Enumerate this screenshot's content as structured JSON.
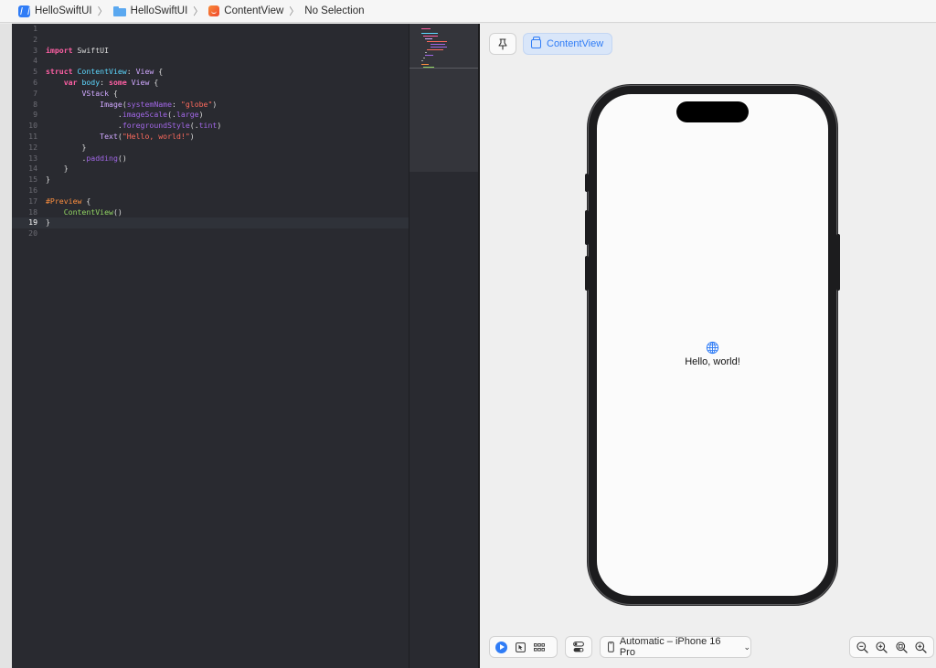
{
  "jumpbar": {
    "project": "HelloSwiftUI",
    "group": "HelloSwiftUI",
    "file": "ContentView",
    "selection": "No Selection"
  },
  "editor": {
    "active_line": 19,
    "line_numbers": [
      "1",
      "2",
      "3",
      "4",
      "5",
      "6",
      "7",
      "8",
      "9",
      "10",
      "11",
      "12",
      "13",
      "14",
      "15",
      "16",
      "17",
      "18",
      "19",
      "20"
    ],
    "code": {
      "l3_kw": "import",
      "l3_mod": " SwiftUI",
      "l5_kw": "struct",
      "l5_name": " ContentView",
      "l5_colon": ": ",
      "l5_proto": "View",
      "l5_brace": " {",
      "l6_kw": "var",
      "l6_name": " body",
      "l6_colon": ": ",
      "l6_some": "some",
      "l6_type": " View",
      "l6_brace": " {",
      "l7_type": "VStack",
      "l7_brace": " {",
      "l8_type": "Image",
      "l8_open": "(",
      "l8_label": "systemName",
      "l8_colon": ": ",
      "l8_str": "\"globe\"",
      "l8_close": ")",
      "l9_dot": ".",
      "l9_fn": "imageScale",
      "l9_open": "(.",
      "l9_arg": "large",
      "l9_close": ")",
      "l10_dot": ".",
      "l10_fn": "foregroundStyle",
      "l10_open": "(.",
      "l10_arg": "tint",
      "l10_close": ")",
      "l11_type": "Text",
      "l11_open": "(",
      "l11_str": "\"Hello, world!\"",
      "l11_close": ")",
      "l12": "}",
      "l13_dot": ".",
      "l13_fn": "padding",
      "l13_paren": "()",
      "l14": "}",
      "l15": "}",
      "l17_macro": "#Preview",
      "l17_brace": " {",
      "l18_name": "ContentView",
      "l18_paren": "()",
      "l19": "}"
    }
  },
  "canvas": {
    "preview_tab": "ContentView",
    "hello_text": "Hello, world!",
    "device": "Automatic – iPhone 16 Pro"
  },
  "colors": {
    "accent": "#2f7cf6",
    "editor_bg": "#292a30",
    "keyword": "#fc5fa3",
    "string": "#fc6a5d"
  },
  "icons": [
    "app-icon",
    "folder-icon",
    "swift-file-icon",
    "pin-icon",
    "preview-window-icon",
    "globe-icon",
    "play-icon",
    "selectable-icon",
    "grid-icon",
    "variants-icon",
    "iphone-icon",
    "zoom-out-icon",
    "zoom-in-icon",
    "zoom-fit-icon",
    "zoom-actual-icon"
  ]
}
